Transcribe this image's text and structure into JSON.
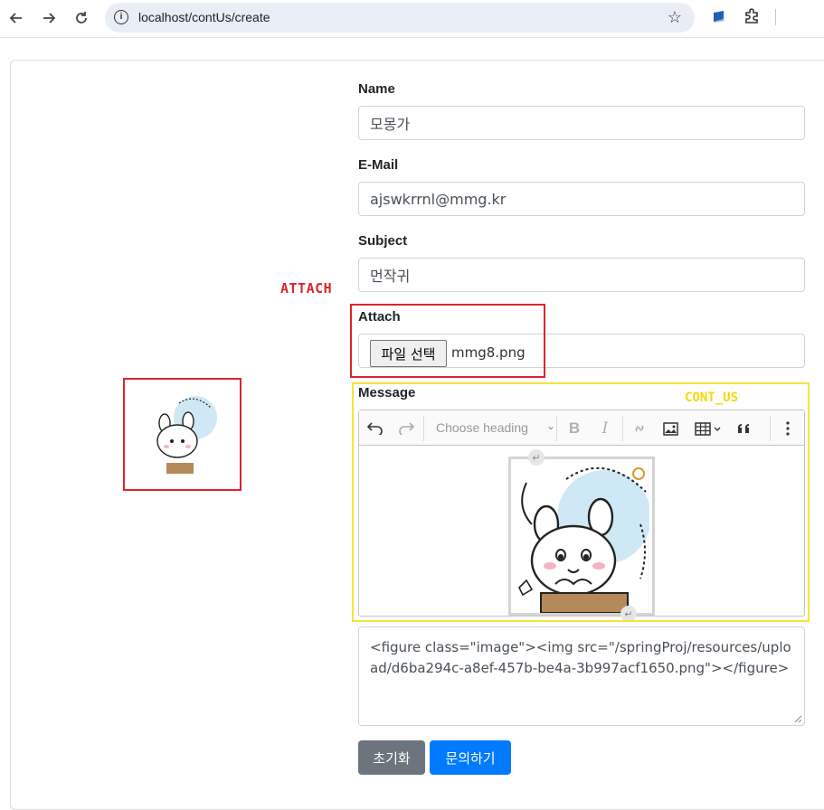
{
  "browser": {
    "url": "localhost/contUs/create",
    "icons": [
      "back-arrow-icon",
      "forward-arrow-icon",
      "reload-icon",
      "site-info-icon",
      "bookmark-star-icon",
      "extension-icon",
      "puzzle-icon"
    ]
  },
  "form": {
    "name": {
      "label": "Name",
      "value": "모몽가"
    },
    "email": {
      "label": "E-Mail",
      "value": "ajswkrrnl@mmg.kr"
    },
    "subject": {
      "label": "Subject",
      "value": "먼작귀"
    },
    "attach": {
      "label": "Attach",
      "button_label": "파일 선택",
      "file_name": "mmg8.png"
    },
    "message": {
      "label": "Message",
      "heading_placeholder": "Choose heading",
      "toolbar_icons": [
        "undo-icon",
        "redo-icon",
        "bold-icon",
        "italic-icon",
        "link-icon",
        "image-icon",
        "table-icon",
        "blockquote-icon",
        "more-icon"
      ],
      "source_html": "<figure class=\"image\"><img src=\"/springProj/resources/upload/d6ba294c-a8ef-457b-be4a-3b997acf1650.png\"></figure>"
    },
    "buttons": {
      "reset": "초기화",
      "submit": "문의하기"
    }
  },
  "annotations": {
    "attach": "ATTACH",
    "content": "CONT_US"
  },
  "colors": {
    "annotation_red": "#d9262c",
    "annotation_yellow": "#f5e33b",
    "primary": "#007bff",
    "secondary": "#6c757d"
  }
}
